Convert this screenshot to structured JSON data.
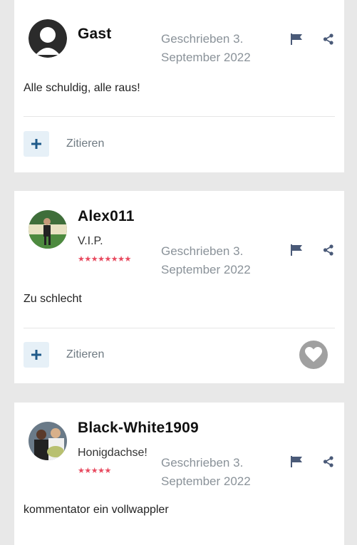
{
  "posts": [
    {
      "author": "Gast",
      "user_title": "",
      "stars": "",
      "date_line1": "Geschrieben 3.",
      "date_line2": "September 2022",
      "content": "Alle schuldig, alle raus!",
      "quote_label": "Zitieren"
    },
    {
      "author": "Alex011",
      "user_title": "V.I.P.",
      "stars": "★★★★★★★★",
      "date_line1": "Geschrieben 3.",
      "date_line2": "September 2022",
      "content": "Zu schlecht",
      "quote_label": "Zitieren"
    },
    {
      "author": "Black-White1909",
      "user_title": "Honigdachse!",
      "stars": "★★★★★",
      "date_line1": "Geschrieben 3.",
      "date_line2": "September 2022",
      "content": "kommentator ein vollwappler"
    }
  ],
  "colors": {
    "accent_button_bg": "#e6f0f7",
    "accent_icon": "#1f5a8a",
    "star": "#e84a5f",
    "date": "#8a9299",
    "like_bg": "#a0a0a0"
  },
  "icons": [
    "guest-avatar-icon",
    "flag-icon",
    "share-icon",
    "plus-icon",
    "heart-icon"
  ]
}
